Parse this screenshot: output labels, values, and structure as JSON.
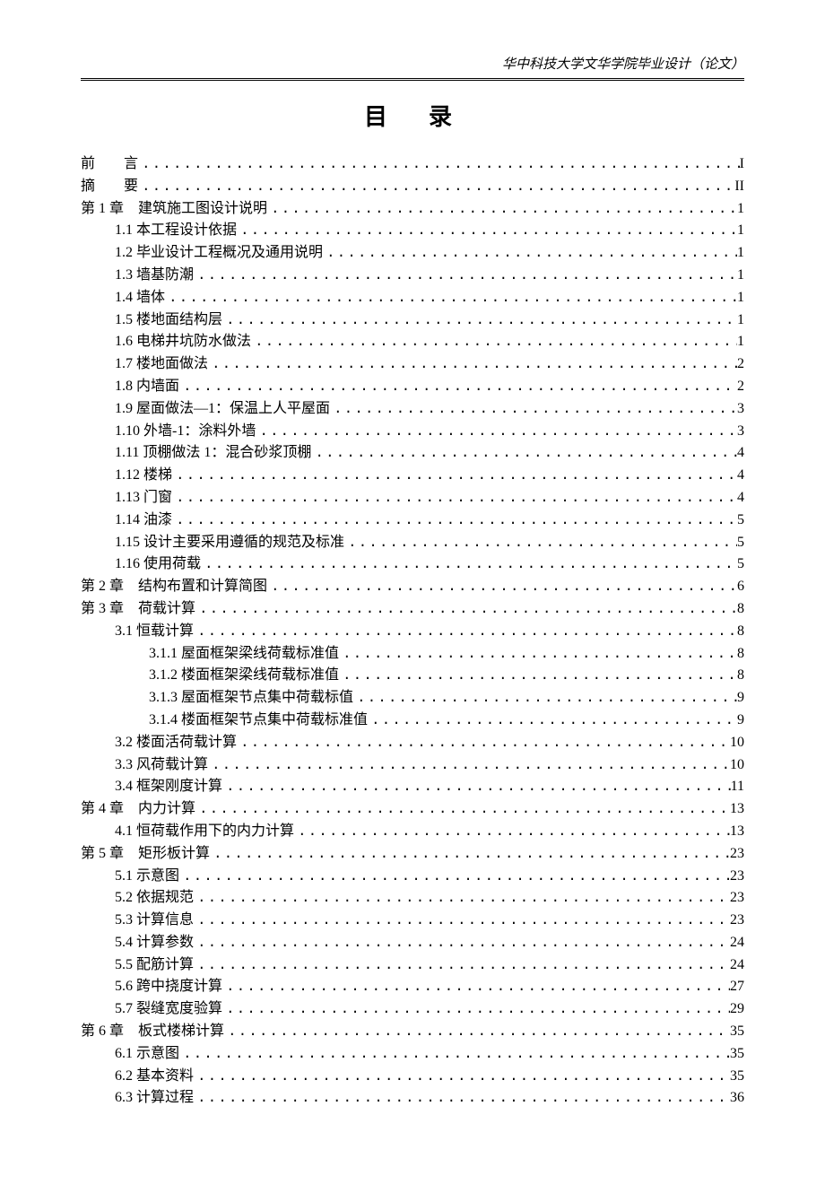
{
  "header": "华中科技大学文华学院毕业设计（论文）",
  "title": "目　录",
  "toc": [
    {
      "indent": 0,
      "label": "前　　言",
      "spaced": false,
      "page": "I"
    },
    {
      "indent": 0,
      "label": "摘　　要",
      "spaced": false,
      "page": "II"
    },
    {
      "indent": 0,
      "label": "第 1 章　建筑施工图设计说明",
      "page": "1"
    },
    {
      "indent": 1,
      "label": "1.1 本工程设计依据",
      "page": "1"
    },
    {
      "indent": 1,
      "label": "1.2 毕业设计工程概况及通用说明",
      "page": "1"
    },
    {
      "indent": 1,
      "label": "1.3 墙基防潮",
      "page": "1"
    },
    {
      "indent": 1,
      "label": "1.4 墙体",
      "page": "1"
    },
    {
      "indent": 1,
      "label": "1.5 楼地面结构层",
      "page": "1"
    },
    {
      "indent": 1,
      "label": "1.6 电梯井坑防水做法",
      "page": "1"
    },
    {
      "indent": 1,
      "label": "1.7 楼地面做法",
      "page": "2"
    },
    {
      "indent": 1,
      "label": "1.8 内墙面",
      "page": "2"
    },
    {
      "indent": 1,
      "label": "1.9 屋面做法—1：保温上人平屋面",
      "page": "3"
    },
    {
      "indent": 1,
      "label": "1.10 外墙-1：涂料外墙",
      "page": "3"
    },
    {
      "indent": 1,
      "label": "1.11 顶棚做法 1：混合砂浆顶棚",
      "page": "4"
    },
    {
      "indent": 1,
      "label": "1.12 楼梯",
      "page": "4"
    },
    {
      "indent": 1,
      "label": "1.13 门窗",
      "page": "4"
    },
    {
      "indent": 1,
      "label": "1.14 油漆",
      "page": "5"
    },
    {
      "indent": 1,
      "label": "1.15 设计主要采用遵循的规范及标准",
      "page": "5"
    },
    {
      "indent": 1,
      "label": "1.16 使用荷载",
      "page": "5"
    },
    {
      "indent": 0,
      "label": "第 2 章　结构布置和计算简图",
      "page": "6"
    },
    {
      "indent": 0,
      "label": "第 3 章　荷载计算",
      "page": "8"
    },
    {
      "indent": 1,
      "label": "3.1 恒载计算",
      "page": "8"
    },
    {
      "indent": 2,
      "label": "3.1.1 屋面框架梁线荷载标准值",
      "page": "8"
    },
    {
      "indent": 2,
      "label": "3.1.2 楼面框架梁线荷载标准值",
      "page": "8"
    },
    {
      "indent": 2,
      "label": "3.1.3 屋面框架节点集中荷载标值",
      "page": "9"
    },
    {
      "indent": 2,
      "label": "3.1.4 楼面框架节点集中荷载标准值",
      "page": "9"
    },
    {
      "indent": 1,
      "label": "3.2 楼面活荷载计算",
      "page": "10"
    },
    {
      "indent": 1,
      "label": "3.3 风荷载计算",
      "page": "10"
    },
    {
      "indent": 1,
      "label": "3.4 框架刚度计算",
      "page": "11"
    },
    {
      "indent": 0,
      "label": "第 4 章　内力计算",
      "page": "13"
    },
    {
      "indent": 1,
      "label": "4.1 恒荷载作用下的内力计算",
      "page": "13"
    },
    {
      "indent": 0,
      "label": "第 5 章　矩形板计算",
      "page": "23"
    },
    {
      "indent": 1,
      "label": "5.1 示意图",
      "page": "23"
    },
    {
      "indent": 1,
      "label": "5.2 依据规范",
      "page": "23"
    },
    {
      "indent": 1,
      "label": "5.3 计算信息",
      "page": "23"
    },
    {
      "indent": 1,
      "label": "5.4 计算参数",
      "page": "24"
    },
    {
      "indent": 1,
      "label": "5.5 配筋计算",
      "page": "24"
    },
    {
      "indent": 1,
      "label": "5.6 跨中挠度计算",
      "page": "27"
    },
    {
      "indent": 1,
      "label": "5.7 裂缝宽度验算",
      "page": "29"
    },
    {
      "indent": 0,
      "label": "第 6 章　板式楼梯计算",
      "page": "35"
    },
    {
      "indent": 1,
      "label": "6.1 示意图",
      "page": "35"
    },
    {
      "indent": 1,
      "label": "6.2 基本资料",
      "page": "35"
    },
    {
      "indent": 1,
      "label": "6.3 计算过程",
      "page": "36"
    }
  ]
}
